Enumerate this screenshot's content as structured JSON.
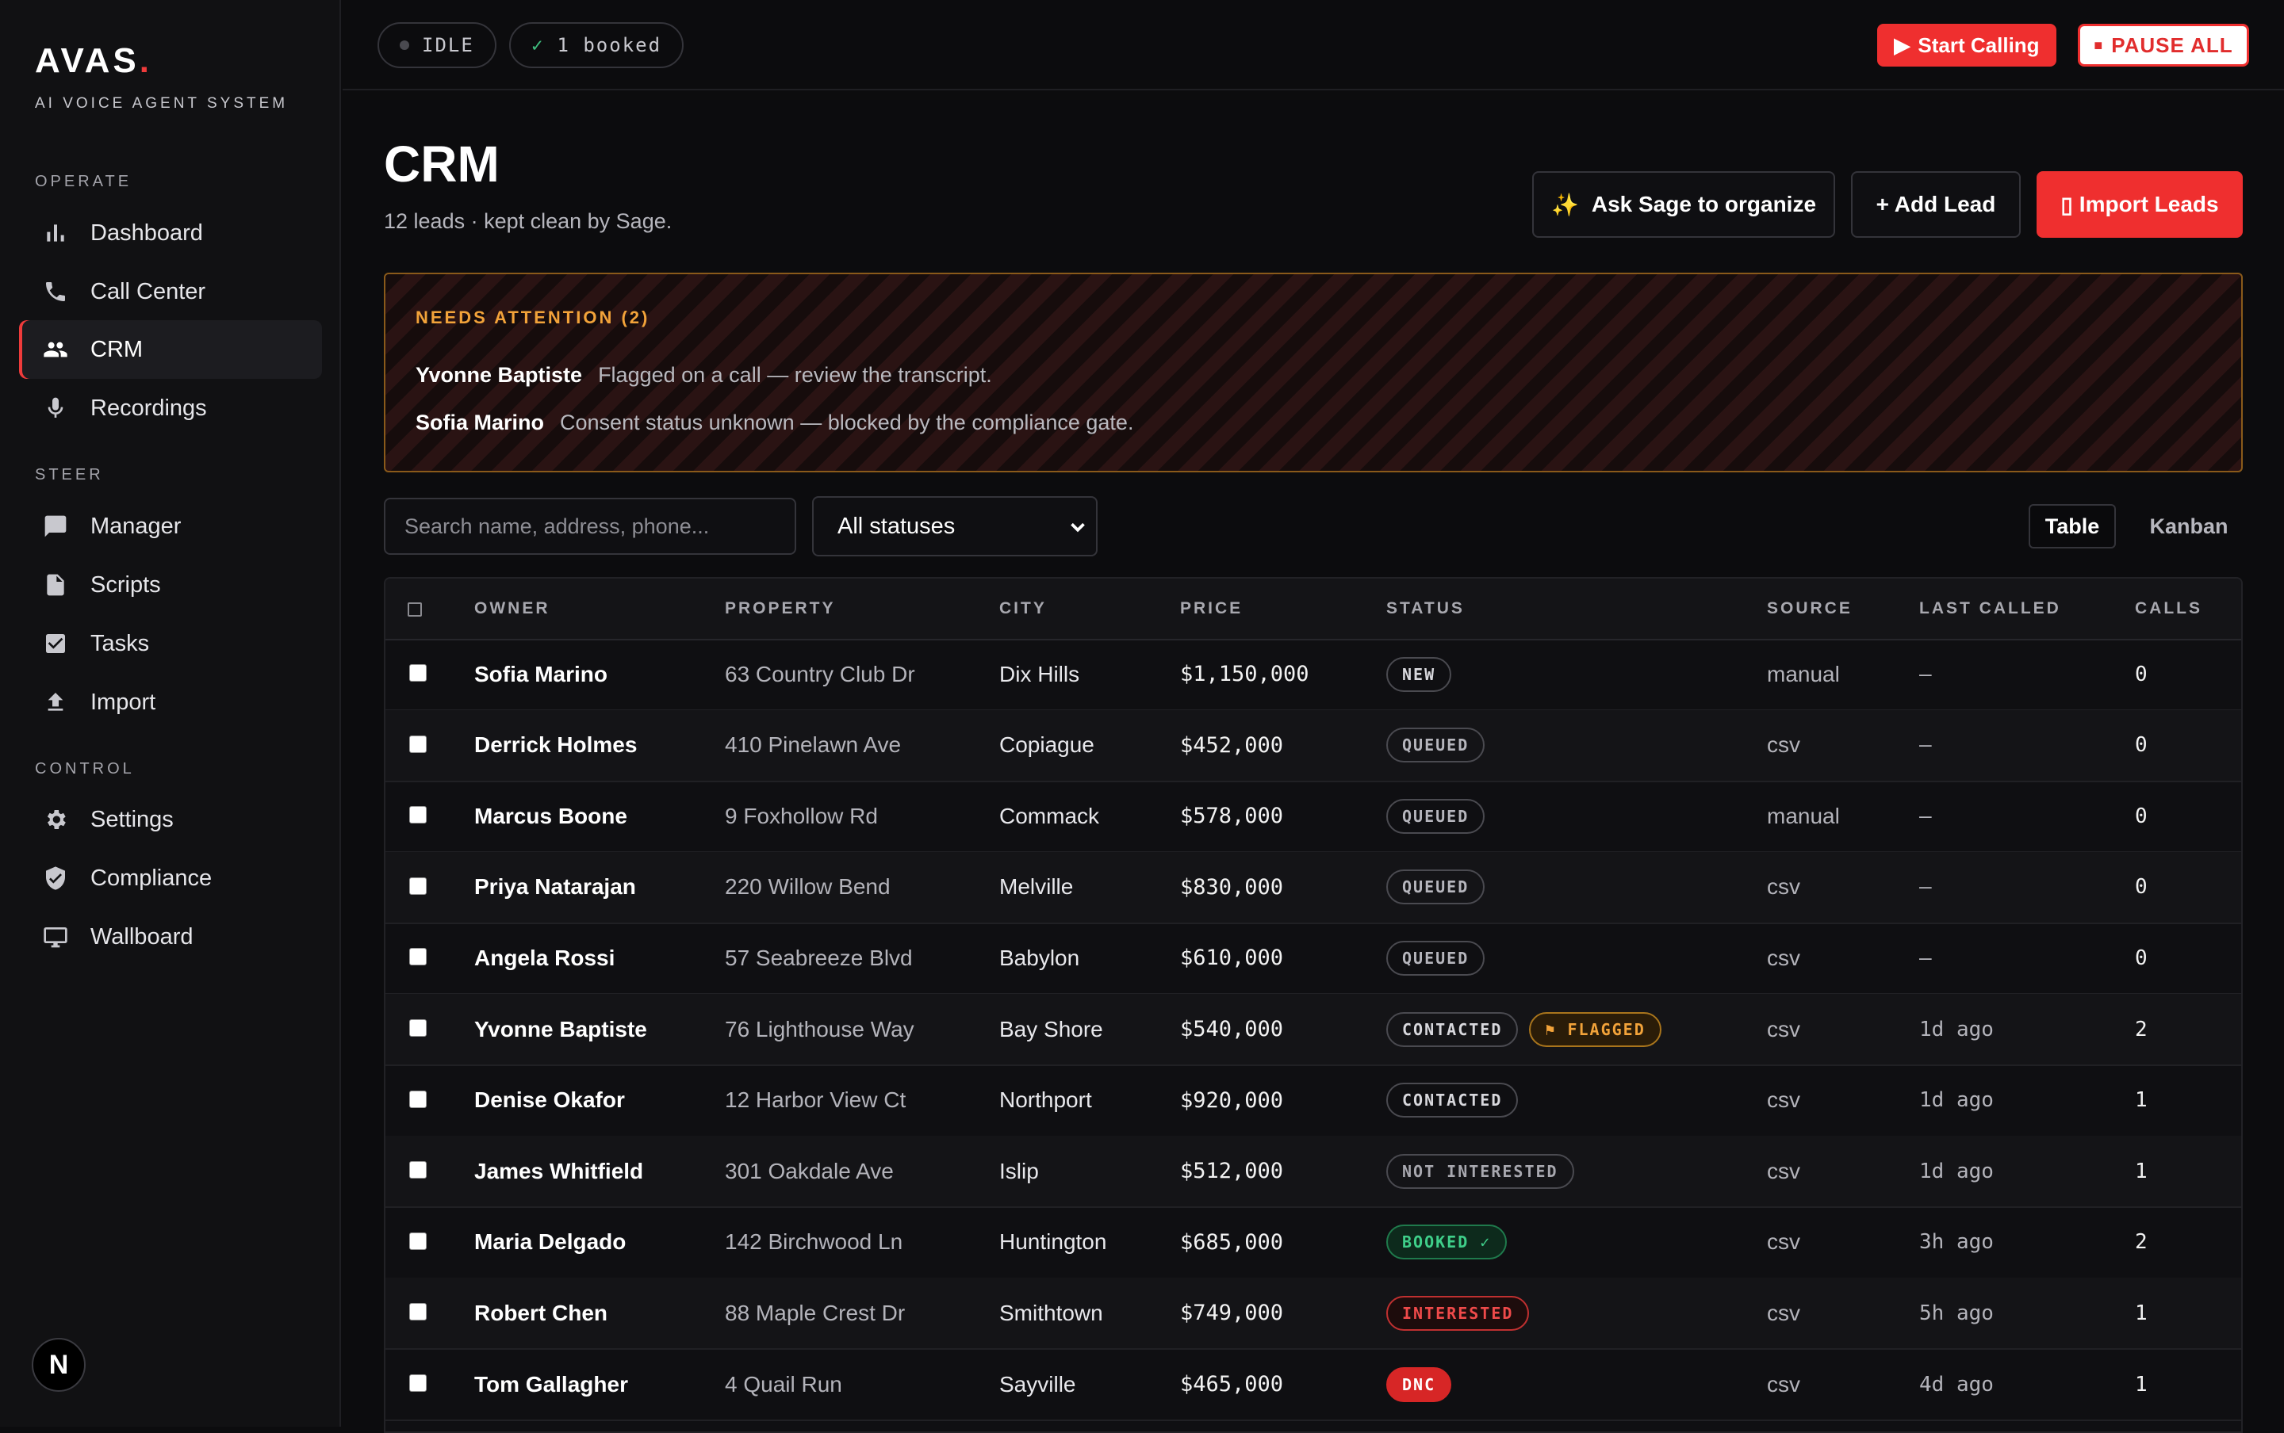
{
  "sidebar": {
    "logo_text": "AVAS",
    "logo_dot": ".",
    "tagline": "AI VOICE AGENT SYSTEM",
    "sections": [
      {
        "title": "OPERATE",
        "items": [
          {
            "label": "Dashboard",
            "icon": "bar-chart-icon"
          },
          {
            "label": "Call Center",
            "icon": "phone-icon"
          },
          {
            "label": "CRM",
            "icon": "people-icon",
            "active": true
          },
          {
            "label": "Recordings",
            "icon": "microphone-icon"
          }
        ]
      },
      {
        "title": "STEER",
        "items": [
          {
            "label": "Manager",
            "icon": "chat-bubble-icon"
          },
          {
            "label": "Scripts",
            "icon": "document-icon"
          },
          {
            "label": "Tasks",
            "icon": "checkbox-icon"
          },
          {
            "label": "Import",
            "icon": "upload-icon"
          }
        ]
      },
      {
        "title": "CONTROL",
        "items": [
          {
            "label": "Settings",
            "icon": "gear-icon"
          },
          {
            "label": "Compliance",
            "icon": "shield-icon"
          },
          {
            "label": "Wallboard",
            "icon": "monitor-icon"
          }
        ]
      }
    ],
    "footer_badge": "N"
  },
  "topbar": {
    "status_pill": "IDLE",
    "booked_check": "✓",
    "booked_pill": "1 booked",
    "start_label": "Start Calling",
    "start_icon": "▶",
    "pause_label": "PAUSE ALL",
    "pause_icon": "■"
  },
  "header": {
    "title": "CRM",
    "subtitle": "12 leads · kept clean by Sage.",
    "ask_sage_label": "Ask Sage to organize",
    "ask_sage_icon": "✨",
    "add_lead_label": "+ Add Lead",
    "import_label": "Import Leads",
    "import_icon": "▯"
  },
  "attention": {
    "title": "NEEDS ATTENTION (2)",
    "items": [
      {
        "name": "Yvonne Baptiste",
        "message": "Flagged on a call — review the transcript."
      },
      {
        "name": "Sofia Marino",
        "message": "Consent status unknown — blocked by the compliance gate."
      }
    ]
  },
  "filters": {
    "search_placeholder": "Search name, address, phone...",
    "status_value": "All statuses",
    "view_table": "Table",
    "view_kanban": "Kanban"
  },
  "table": {
    "select_all_glyph": "◻",
    "columns": [
      "OWNER",
      "PROPERTY",
      "CITY",
      "PRICE",
      "STATUS",
      "SOURCE",
      "LAST CALLED",
      "CALLS"
    ],
    "rows": [
      {
        "owner": "Sofia Marino",
        "property": "63 Country Club Dr",
        "city": "Dix Hills",
        "price": "$1,150,000",
        "status": "NEW",
        "status_kind": "new",
        "flag": "",
        "source": "manual",
        "last_called": "–",
        "calls": "0"
      },
      {
        "owner": "Derrick Holmes",
        "property": "410 Pinelawn Ave",
        "city": "Copiague",
        "price": "$452,000",
        "status": "QUEUED",
        "status_kind": "queued",
        "flag": "",
        "source": "csv",
        "last_called": "–",
        "calls": "0"
      },
      {
        "owner": "Marcus Boone",
        "property": "9 Foxhollow Rd",
        "city": "Commack",
        "price": "$578,000",
        "status": "QUEUED",
        "status_kind": "queued",
        "flag": "",
        "source": "manual",
        "last_called": "–",
        "calls": "0"
      },
      {
        "owner": "Priya Natarajan",
        "property": "220 Willow Bend",
        "city": "Melville",
        "price": "$830,000",
        "status": "QUEUED",
        "status_kind": "queued",
        "flag": "",
        "source": "csv",
        "last_called": "–",
        "calls": "0"
      },
      {
        "owner": "Angela Rossi",
        "property": "57 Seabreeze Blvd",
        "city": "Babylon",
        "price": "$610,000",
        "status": "QUEUED",
        "status_kind": "queued",
        "flag": "",
        "source": "csv",
        "last_called": "–",
        "calls": "0"
      },
      {
        "owner": "Yvonne Baptiste",
        "property": "76 Lighthouse Way",
        "city": "Bay Shore",
        "price": "$540,000",
        "status": "CONTACTED",
        "status_kind": "contacted",
        "flag": "⚑ FLAGGED",
        "source": "csv",
        "last_called": "1d ago",
        "calls": "2"
      },
      {
        "owner": "Denise Okafor",
        "property": "12 Harbor View Ct",
        "city": "Northport",
        "price": "$920,000",
        "status": "CONTACTED",
        "status_kind": "contacted",
        "flag": "",
        "source": "csv",
        "last_called": "1d ago",
        "calls": "1"
      },
      {
        "owner": "James Whitfield",
        "property": "301 Oakdale Ave",
        "city": "Islip",
        "price": "$512,000",
        "status": "NOT INTERESTED",
        "status_kind": "notint",
        "flag": "",
        "source": "csv",
        "last_called": "1d ago",
        "calls": "1"
      },
      {
        "owner": "Maria Delgado",
        "property": "142 Birchwood Ln",
        "city": "Huntington",
        "price": "$685,000",
        "status": "BOOKED ✓",
        "status_kind": "booked",
        "flag": "",
        "source": "csv",
        "last_called": "3h ago",
        "calls": "2"
      },
      {
        "owner": "Robert Chen",
        "property": "88 Maple Crest Dr",
        "city": "Smithtown",
        "price": "$749,000",
        "status": "INTERESTED",
        "status_kind": "interested",
        "flag": "",
        "source": "csv",
        "last_called": "5h ago",
        "calls": "1"
      },
      {
        "owner": "Tom Gallagher",
        "property": "4 Quail Run",
        "city": "Sayville",
        "price": "$465,000",
        "status": "DNC",
        "status_kind": "dnc",
        "flag": "",
        "source": "csv",
        "last_called": "4d ago",
        "calls": "1"
      }
    ]
  },
  "colors": {
    "accent_red": "#ef2f2f",
    "warning_amber": "#f2a33a",
    "success_green": "#3fcf8a",
    "background": "#0c0c0e"
  }
}
